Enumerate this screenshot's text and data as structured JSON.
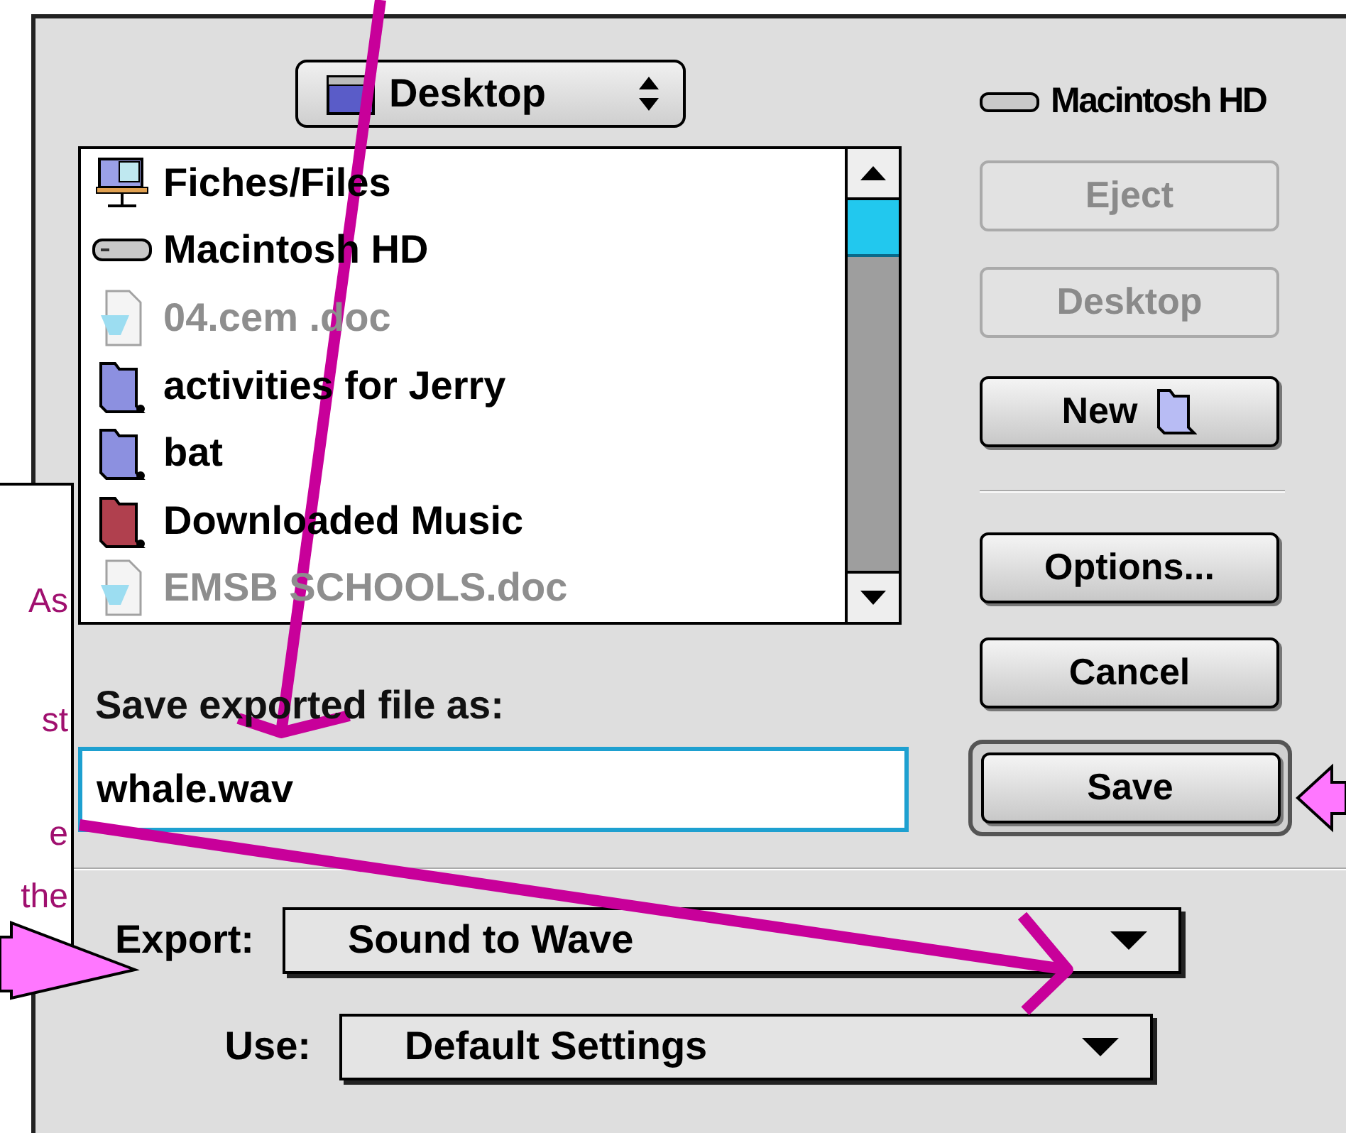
{
  "location_popup": {
    "label": "Desktop"
  },
  "volume": {
    "label": "Macintosh HD"
  },
  "files": [
    {
      "name": "Fiches/Files",
      "kind": "shared",
      "dimmed": false
    },
    {
      "name": "Macintosh HD",
      "kind": "drive",
      "dimmed": false
    },
    {
      "name": "04.cem .doc",
      "kind": "document",
      "dimmed": true
    },
    {
      "name": "activities for Jerry",
      "kind": "folder",
      "color": "#8c90e0",
      "dimmed": false
    },
    {
      "name": "bat",
      "kind": "folder",
      "color": "#8c90e0",
      "dimmed": false
    },
    {
      "name": "Downloaded Music",
      "kind": "folder",
      "color": "#b0404e",
      "dimmed": false
    },
    {
      "name": "EMSB SCHOOLS.doc",
      "kind": "document",
      "dimmed": true
    }
  ],
  "side_buttons": [
    {
      "label": "Eject",
      "kind": "plain",
      "disabled": true
    },
    {
      "label": "Desktop",
      "kind": "plain",
      "disabled": true
    },
    {
      "label": "New",
      "kind": "new-folder",
      "disabled": false
    },
    {
      "kind": "divider"
    },
    {
      "label": "Options...",
      "kind": "plain",
      "disabled": false
    },
    {
      "label": "Cancel",
      "kind": "plain",
      "disabled": false
    },
    {
      "label": "Save",
      "kind": "default",
      "disabled": false
    }
  ],
  "filename": {
    "label": "Save exported file as:",
    "value": "whale.wav"
  },
  "export": {
    "label": "Export:",
    "value": "Sound to Wave"
  },
  "use": {
    "label": "Use:",
    "value": "Default Settings"
  },
  "callout": {
    "lines": [
      "As",
      "st",
      "e",
      "the"
    ]
  }
}
